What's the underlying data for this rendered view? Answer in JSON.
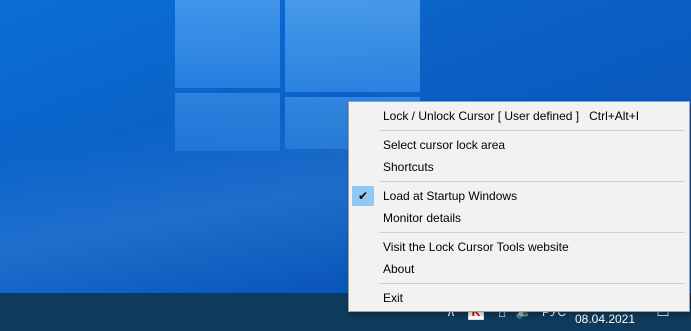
{
  "menu": {
    "items": [
      {
        "label": "Lock / Unlock Cursor [ User defined ]",
        "shortcut": "Ctrl+Alt+I"
      },
      {
        "label": "Select cursor lock area"
      },
      {
        "label": "Shortcuts"
      },
      {
        "label": "Load at Startup Windows",
        "checked": true
      },
      {
        "label": "Monitor details"
      },
      {
        "label": "Visit the Lock Cursor Tools website"
      },
      {
        "label": "About"
      },
      {
        "label": "Exit"
      }
    ],
    "check_glyph": "✔",
    "checked_highlight_color": "#90c8f6"
  },
  "taskbar": {
    "chevron_glyph": "∧",
    "app_icon_letter": "K",
    "network_glyph": "⌂",
    "volume_glyph": "🔈",
    "language": "РУС",
    "date": "08.04.2021",
    "notification_glyph": "▭",
    "icons": [
      "chevron-up-icon",
      "lock-cursor-app-icon",
      "network-icon",
      "volume-icon",
      "notification-icon"
    ]
  },
  "colors": {
    "desktop_blue": "#0b5fc4",
    "taskbar": "#0e3a5c",
    "menu_background": "#f2f2f2"
  }
}
